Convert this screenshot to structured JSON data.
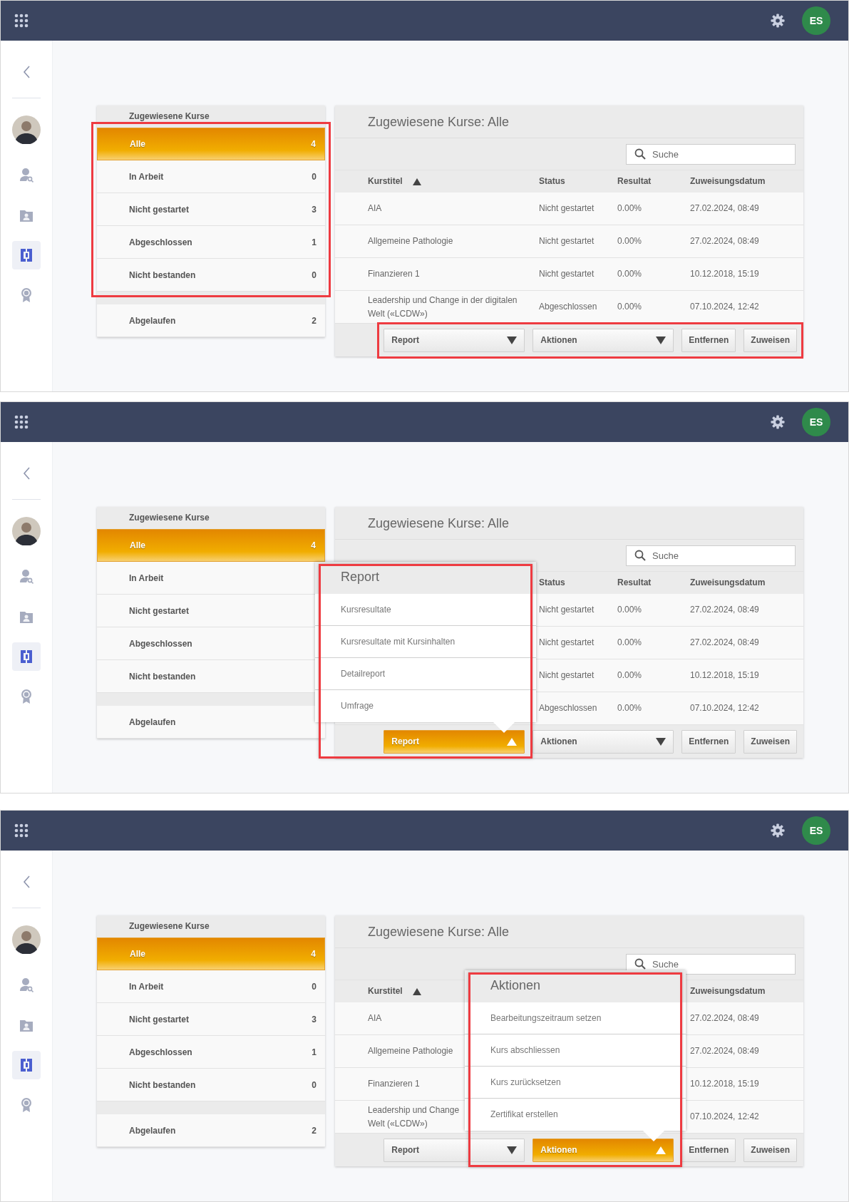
{
  "panels": [
    {
      "top_bar": {
        "initials": "ES"
      },
      "sidebar": {
        "items": [
          {
            "selected": false
          },
          {
            "selected": false
          },
          {
            "selected": true
          },
          {
            "selected": false
          }
        ]
      },
      "filter_list": {
        "title": "Zugewiesene Kurse",
        "groups": [
          {
            "highlighted": true,
            "items": [
              {
                "label": "Alle",
                "count": "4",
                "selected": true
              },
              {
                "label": "In Arbeit",
                "count": "0",
                "selected": false
              },
              {
                "label": "Nicht gestartet",
                "count": "3",
                "selected": false
              },
              {
                "label": "Abgeschlossen",
                "count": "1",
                "selected": false
              },
              {
                "label": "Nicht bestanden",
                "count": "0",
                "selected": false
              }
            ]
          },
          {
            "items": [
              {
                "label": "Abgelaufen",
                "count": "2",
                "selected": false
              }
            ]
          }
        ]
      },
      "course_table": {
        "title": "Zugewiesene Kurse: Alle",
        "search": {
          "placeholder": "Suche"
        },
        "columns": [
          {
            "kind": "title",
            "label": "Kurstitel",
            "sort_ascending": true
          },
          {
            "kind": "status",
            "label": "Status"
          },
          {
            "kind": "result",
            "label": "Resultat"
          },
          {
            "kind": "date",
            "label": "Zuweisungsdatum"
          }
        ],
        "rows": [
          {
            "title": "AIA",
            "status": "Nicht gestartet",
            "result": "0.00%",
            "date": "27.02.2024, 08:49"
          },
          {
            "title": "Allgemeine Pathologie",
            "status": "Nicht gestartet",
            "result": "0.00%",
            "date": "27.02.2024, 08:49"
          },
          {
            "title": "Finanzieren 1",
            "status": "Nicht gestartet",
            "result": "0.00%",
            "date": "10.12.2018, 15:19"
          },
          {
            "title": "Leadership und Change in der digitalen Welt («LCDW»)",
            "status": "Abgeschlossen",
            "result": "0.00%",
            "date": "07.10.2024, 12:42"
          }
        ]
      },
      "button_bar": {
        "highlighted": true,
        "buttons": [
          {
            "kind": "dropdown",
            "label": "Report",
            "open": false
          },
          {
            "kind": "dropdown",
            "label": "Aktionen",
            "open": false
          },
          {
            "kind": "button",
            "label": "Entfernen"
          },
          {
            "kind": "button",
            "label": "Zuweisen"
          }
        ]
      }
    },
    {
      "top_bar": {
        "initials": "ES"
      },
      "sidebar": {
        "items": [
          {
            "selected": false
          },
          {
            "selected": false
          },
          {
            "selected": true
          },
          {
            "selected": false
          }
        ]
      },
      "filter_list": {
        "title": "Zugewiesene Kurse",
        "groups": [
          {
            "items": [
              {
                "label": "Alle",
                "count": "4",
                "selected": true
              },
              {
                "label": "In Arbeit",
                "selected": false
              },
              {
                "label": "Nicht gestartet",
                "selected": false
              },
              {
                "label": "Abgeschlossen",
                "selected": false
              },
              {
                "label": "Nicht bestanden",
                "selected": false
              }
            ]
          },
          {
            "items": [
              {
                "label": "Abgelaufen",
                "selected": false
              }
            ]
          }
        ]
      },
      "course_table": {
        "title": "Zugewiesene Kurse: Alle",
        "search": {
          "placeholder": "Suche"
        },
        "columns": [
          {
            "kind": "status",
            "label": "Status"
          },
          {
            "kind": "result",
            "label": "Resultat"
          },
          {
            "kind": "date",
            "label": "Zuweisungsdatum"
          }
        ],
        "rows": [
          {
            "status": "Nicht gestartet",
            "result": "0.00%",
            "date": "27.02.2024, 08:49"
          },
          {
            "status": "Nicht gestartet",
            "result": "0.00%",
            "date": "27.02.2024, 08:49"
          },
          {
            "status": "Nicht gestartet",
            "result": "0.00%",
            "date": "10.12.2018, 15:19"
          },
          {
            "status": "Abgeschlossen",
            "result": "0.00%",
            "date": "07.10.2024, 12:42"
          }
        ]
      },
      "button_bar": {
        "highlighted": false,
        "buttons": [
          {
            "kind": "dropdown",
            "label": "Report",
            "open": true
          },
          {
            "kind": "dropdown",
            "label": "Aktionen",
            "open": false
          },
          {
            "kind": "button",
            "label": "Entfernen"
          },
          {
            "kind": "button",
            "label": "Zuweisen"
          }
        ]
      },
      "menu": {
        "title": "Report",
        "highlighted": true,
        "items": [
          "Kursresultate",
          "Kursresultate mit Kursinhalten",
          "Detailreport",
          "Umfrage"
        ]
      }
    },
    {
      "top_bar": {
        "initials": "ES"
      },
      "sidebar": {
        "items": [
          {
            "selected": false
          },
          {
            "selected": false
          },
          {
            "selected": true
          },
          {
            "selected": false
          }
        ]
      },
      "filter_list": {
        "title": "Zugewiesene Kurse",
        "groups": [
          {
            "items": [
              {
                "label": "Alle",
                "count": "4",
                "selected": true
              },
              {
                "label": "In Arbeit",
                "count": "0",
                "selected": false
              },
              {
                "label": "Nicht gestartet",
                "count": "3",
                "selected": false
              },
              {
                "label": "Abgeschlossen",
                "count": "1",
                "selected": false
              },
              {
                "label": "Nicht bestanden",
                "count": "0",
                "selected": false
              }
            ]
          },
          {
            "items": [
              {
                "label": "Abgelaufen",
                "count": "2",
                "selected": false
              }
            ]
          }
        ]
      },
      "course_table": {
        "title": "Zugewiesene Kurse: Alle",
        "search": {
          "placeholder": "Suche"
        },
        "columns": [
          {
            "kind": "title",
            "label": "Kurstitel",
            "sort_ascending": true
          },
          {
            "kind": "date",
            "label": "Zuweisungsdatum"
          }
        ],
        "rows": [
          {
            "title": "AIA",
            "date": "27.02.2024, 08:49"
          },
          {
            "title": "Allgemeine Pathologie",
            "date": "27.02.2024, 08:49"
          },
          {
            "title": "Finanzieren 1",
            "date": "10.12.2018, 15:19"
          },
          {
            "title": "Leadership und Change\nWelt («LCDW»)",
            "date": "07.10.2024, 12:42"
          }
        ]
      },
      "button_bar": {
        "highlighted": false,
        "buttons": [
          {
            "kind": "dropdown",
            "label": "Report",
            "open": false
          },
          {
            "kind": "dropdown",
            "label": "Aktionen",
            "open": true
          },
          {
            "kind": "button",
            "label": "Entfernen"
          },
          {
            "kind": "button",
            "label": "Zuweisen"
          }
        ]
      },
      "menu": {
        "title": "Aktionen",
        "highlighted": true,
        "items": [
          "Bearbeitungszeitraum setzen",
          "Kurs abschliessen",
          "Kurs zurücksetzen",
          "Zertifikat erstellen"
        ]
      }
    }
  ]
}
